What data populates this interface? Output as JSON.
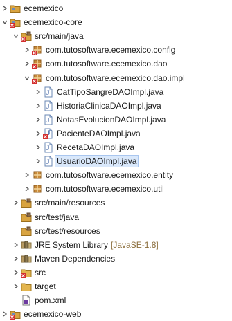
{
  "tree": {
    "items": [
      {
        "label": "ecemexico",
        "level": 0,
        "toggle": "collapsed",
        "icon": "project-icon"
      },
      {
        "label": "ecemexico-core",
        "level": 0,
        "toggle": "expanded",
        "icon": "project-error-icon"
      },
      {
        "label": "src/main/java",
        "level": 1,
        "toggle": "expanded",
        "icon": "source-folder-error-icon"
      },
      {
        "label": "com.tutosoftware.ecemexico.config",
        "level": 2,
        "toggle": "collapsed",
        "icon": "package-error-icon"
      },
      {
        "label": "com.tutosoftware.ecemexico.dao",
        "level": 2,
        "toggle": "collapsed",
        "icon": "package-error-icon"
      },
      {
        "label": "com.tutosoftware.ecemexico.dao.impl",
        "level": 2,
        "toggle": "expanded",
        "icon": "package-error-icon"
      },
      {
        "label": "CatTipoSangreDAOImpl.java",
        "level": 3,
        "toggle": "collapsed",
        "icon": "java-file-icon"
      },
      {
        "label": "HistoriaClinicaDAOImpl.java",
        "level": 3,
        "toggle": "collapsed",
        "icon": "java-file-icon"
      },
      {
        "label": "NotasEvolucionDAOImpl.java",
        "level": 3,
        "toggle": "collapsed",
        "icon": "java-file-icon"
      },
      {
        "label": "PacienteDAOImpl.java",
        "level": 3,
        "toggle": "collapsed",
        "icon": "java-file-error-icon"
      },
      {
        "label": "RecetaDAOImpl.java",
        "level": 3,
        "toggle": "collapsed",
        "icon": "java-file-icon"
      },
      {
        "label": "UsuarioDAOImpl.java",
        "level": 3,
        "toggle": "collapsed",
        "icon": "java-file-icon",
        "selected": true
      },
      {
        "label": "com.tutosoftware.ecemexico.entity",
        "level": 2,
        "toggle": "collapsed",
        "icon": "package-icon"
      },
      {
        "label": "com.tutosoftware.ecemexico.util",
        "level": 2,
        "toggle": "collapsed",
        "icon": "package-icon"
      },
      {
        "label": "src/main/resources",
        "level": 1,
        "toggle": "collapsed",
        "icon": "source-folder-icon"
      },
      {
        "label": "src/test/java",
        "level": 1,
        "toggle": "none",
        "icon": "source-folder-icon"
      },
      {
        "label": "src/test/resources",
        "level": 1,
        "toggle": "none",
        "icon": "source-folder-icon"
      },
      {
        "label": "JRE System Library",
        "decoration": "[JavaSE-1.8]",
        "level": 1,
        "toggle": "collapsed",
        "icon": "library-icon"
      },
      {
        "label": "Maven Dependencies",
        "level": 1,
        "toggle": "collapsed",
        "icon": "library-icon"
      },
      {
        "label": "src",
        "level": 1,
        "toggle": "collapsed",
        "icon": "folder-error-icon"
      },
      {
        "label": "target",
        "level": 1,
        "toggle": "collapsed",
        "icon": "folder-icon"
      },
      {
        "label": "pom.xml",
        "level": 1,
        "toggle": "none",
        "icon": "xml-file-icon"
      },
      {
        "label": "ecemexico-web",
        "level": 0,
        "toggle": "collapsed",
        "icon": "project-error-icon"
      }
    ]
  }
}
